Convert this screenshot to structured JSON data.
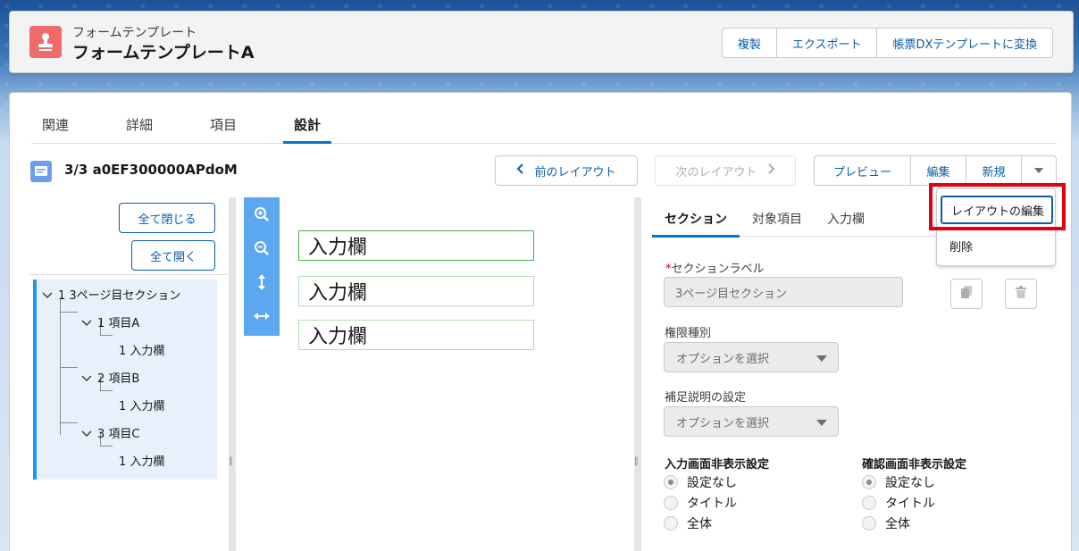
{
  "header": {
    "object_label": "フォームテンプレート",
    "record_name": "フォームテンプレートA",
    "actions": [
      "複製",
      "エクスポート",
      "帳票DXテンプレートに変換"
    ]
  },
  "tabs": [
    "関連",
    "詳細",
    "項目",
    "設計"
  ],
  "active_tab": "設計",
  "layout": {
    "record_title": "3/3 a0EF300000APdoM",
    "prev_label": "前のレイアウト",
    "next_label": "次のレイアウト",
    "actions": [
      "プレビュー",
      "編集",
      "新規"
    ]
  },
  "tree": {
    "collapse_all": "全て閉じる",
    "expand_all": "全て開く",
    "nodes": [
      {
        "label": "1 3ページ目セクション"
      },
      {
        "label": "1 項目A"
      },
      {
        "label": "1 入力欄"
      },
      {
        "label": "2 項目B"
      },
      {
        "label": "1 入力欄"
      },
      {
        "label": "3 項目C"
      },
      {
        "label": "1 入力欄"
      }
    ]
  },
  "canvas": {
    "fields": [
      "入力欄",
      "入力欄",
      "入力欄"
    ],
    "tools": [
      "zoom-in-icon",
      "zoom-out-icon",
      "vertical-resize-icon",
      "horizontal-resize-icon"
    ]
  },
  "props": {
    "tabs": [
      "セクション",
      "対象項目",
      "入力欄"
    ],
    "section_label_label": "セクションラベル",
    "required_mark": "*",
    "section_label_value": "3ページ目セクション",
    "permission_label": "権限種別",
    "permission_value": "オプションを選択",
    "supplement_label": "補足説明の設定",
    "supplement_value": "オプションを選択",
    "input_hide_label": "入力画面非表示設定",
    "confirm_hide_label": "確認画面非表示設定",
    "radio_options": [
      "設定なし",
      "タイトル",
      "全体"
    ]
  },
  "dropdown": {
    "items": [
      "レイアウトの編集",
      "削除"
    ]
  },
  "colors": {
    "brand": "#0176d3",
    "link": "#0b5cab",
    "highlight": "#e3000f"
  }
}
